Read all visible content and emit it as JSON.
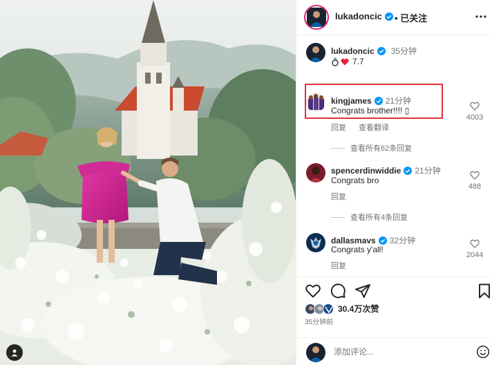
{
  "post": {
    "author": "lukadoncic",
    "follow_status": "已关注",
    "caption_user": "lukadoncic",
    "caption_time": "35分钟",
    "caption_text": "7.7",
    "caption_emoji": [
      "ring-icon",
      "red-heart-icon"
    ]
  },
  "comments": [
    {
      "user": "kingjames",
      "time": "21分钟",
      "text": "Congrats brother!!!! ",
      "trailing_glyph": "▯",
      "reply_label": "回复",
      "translate_label": "查看翻译",
      "likes": "4003",
      "view_replies": "查看所有62条回复",
      "highlighted": true
    },
    {
      "user": "spencerdinwiddie",
      "time": "21分钟",
      "text": "Congrats bro",
      "reply_label": "回复",
      "likes": "488",
      "view_replies": "查看所有4条回复"
    },
    {
      "user": "dallasmavs",
      "time": "32分钟",
      "text": "Congrats y'all!",
      "reply_label": "回复",
      "likes": "2044"
    }
  ],
  "likes_summary": "30.4万次赞",
  "post_age": "35分钟前",
  "add_comment": {
    "placeholder": "添加评论..."
  },
  "colors": {
    "highlight_border": "#e0303a",
    "verified": "#0095f6",
    "heart": "#ed1c40",
    "muted_text": "#737373"
  },
  "icons": {
    "header": "more-horizontal-icon",
    "actions": [
      "heart-icon",
      "comment-icon",
      "share-icon",
      "bookmark-icon"
    ],
    "comment_like": "heart-outline-icon",
    "emoji": "smiley-icon"
  }
}
